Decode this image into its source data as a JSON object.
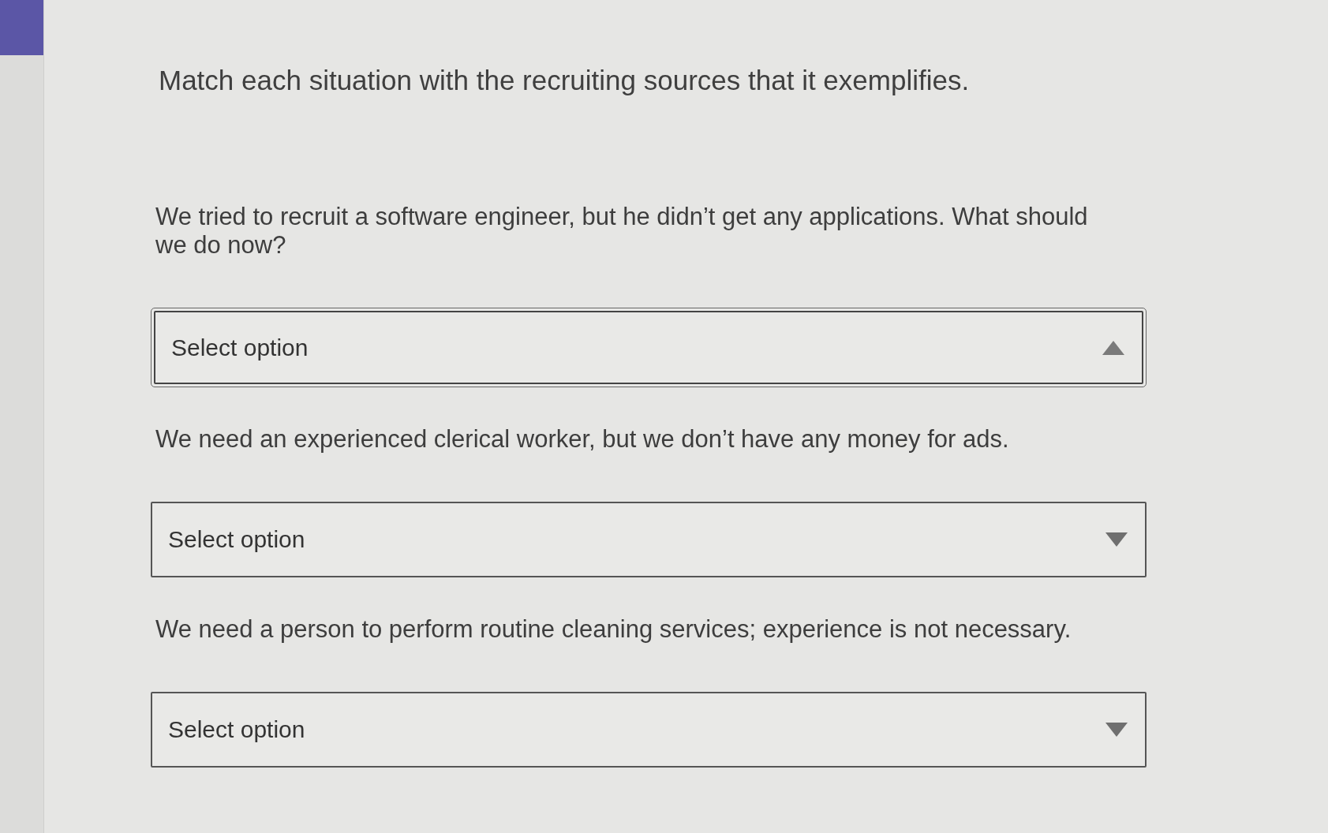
{
  "title": "Match each situation with the recruiting sources that it exemplifies.",
  "items": [
    {
      "situation": "We tried to recruit a software engineer, but he didn’t get any applications. What should we do now?",
      "dropdown": {
        "placeholder": "Select option",
        "expanded": true
      }
    },
    {
      "situation": "We need an experienced clerical worker, but we don’t have any money for ads.",
      "dropdown": {
        "placeholder": "Select option",
        "expanded": false
      }
    },
    {
      "situation": "We need a person to perform routine cleaning services; experience is not necessary.",
      "dropdown": {
        "placeholder": "Select option",
        "expanded": false
      }
    }
  ]
}
